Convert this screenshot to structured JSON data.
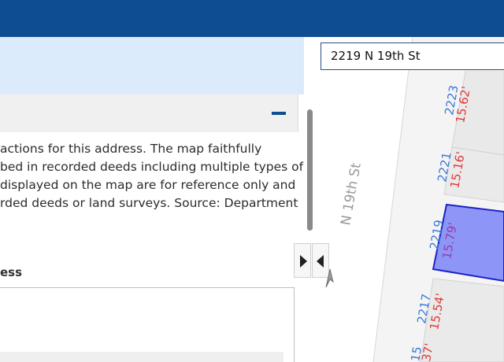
{
  "search": {
    "value": "2219 N 19th St"
  },
  "panel": {
    "description_lines": [
      "actions for this address. The map faithfully",
      "bed in recorded deeds including multiple types of",
      "displayed on the map are for reference only and",
      "rded deeds or land surveys. Source: Department"
    ],
    "field_label": "ess"
  },
  "map": {
    "street_label": "N 19th St",
    "parcels": [
      {
        "number": "2223",
        "frontage": "15.62'"
      },
      {
        "number": "2221",
        "frontage": "15.16'"
      },
      {
        "number": "2219",
        "frontage": "15.79'",
        "selected": true
      },
      {
        "number": "2217",
        "frontage": "15.54'"
      },
      {
        "number": "15",
        "frontage": "37'"
      }
    ],
    "colors": {
      "parcel_number": "#3a77d8",
      "frontage": "#e03a3a",
      "selected_fill": "#8d96f6",
      "selected_border": "#1d22c8"
    }
  },
  "colors": {
    "topbar": "#0f4d92",
    "info_band": "#dcebfb"
  }
}
